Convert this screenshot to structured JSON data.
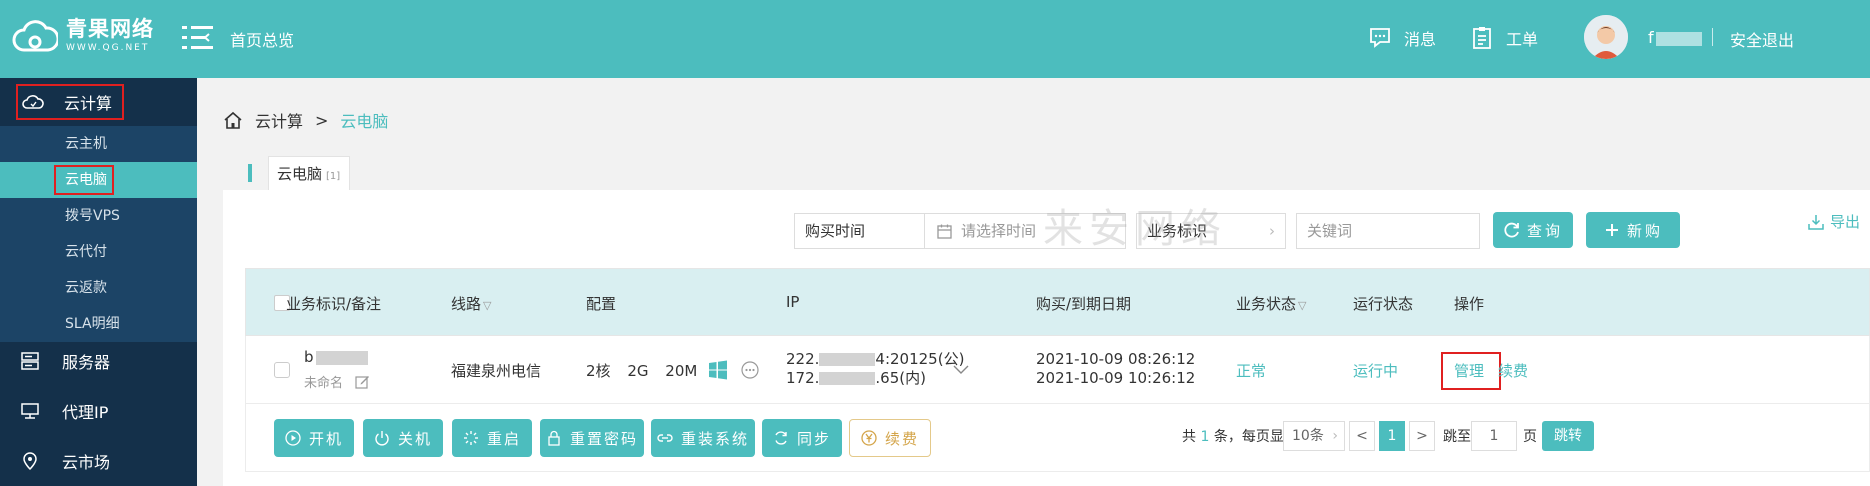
{
  "header": {
    "logo_main": "青果网络",
    "logo_sub": "WWW.QG.NET",
    "home_title": "首页总览",
    "messages": "消息",
    "tickets": "工单",
    "username": "f",
    "logout": "安全退出"
  },
  "sidebar": {
    "cloud_compute": "云计算",
    "sub_items": [
      "云主机",
      "云电脑",
      "拨号VPS",
      "云代付",
      "云返款",
      "SLA明细"
    ],
    "servers": "服务器",
    "proxy_ip": "代理IP",
    "cloud_market": "云市场"
  },
  "breadcrumb": {
    "root": "云计算",
    "sep": ">",
    "current": "云电脑"
  },
  "tab": {
    "label": "云电脑",
    "count": "[1]"
  },
  "filters": {
    "buy_time": "购买时间",
    "date_placeholder": "请选择时间",
    "biz_tag": "业务标识",
    "keyword_placeholder": "关键词",
    "query": "查询",
    "new_purchase": "新购",
    "export": "导出"
  },
  "watermark": "来安网络",
  "table": {
    "headers": [
      "业务标识/备注",
      "线路",
      "配置",
      "IP",
      "购买/到期日期",
      "业务状态",
      "运行状态",
      "操作"
    ],
    "row": {
      "biz_id": "b",
      "remark": "未命名",
      "line": "福建泉州电信",
      "cpu": "2核",
      "ram": "2G",
      "bandwidth": "20M",
      "ip_public_prefix": "222.",
      "ip_public_suffix": "4:20125(公)",
      "ip_private_prefix": "172.",
      "ip_private_suffix": ".65(内)",
      "buy_date": "2021-10-09 08:26:12",
      "expire_date": "2021-10-09 10:26:12",
      "biz_status": "正常",
      "run_status": "运行中",
      "manage": "管理",
      "renew": "续费"
    }
  },
  "actions": {
    "power_on": "开机",
    "power_off": "关机",
    "restart": "重启",
    "reset_password": "重置密码",
    "reinstall": "重装系统",
    "sync": "同步",
    "renew": "续费"
  },
  "pagination": {
    "total_prefix": "共",
    "total_count": "1",
    "total_suffix": "条，每页显示",
    "page_size": "10条",
    "prev": "<",
    "current_page": "1",
    "next": ">",
    "goto_label": "跳至",
    "goto_value": "1",
    "page_unit": "页",
    "goto_button": "跳转"
  },
  "colors": {
    "brand": "#4cbdbe",
    "sidebar": "#14304a",
    "highlight_border": "#e02020"
  }
}
